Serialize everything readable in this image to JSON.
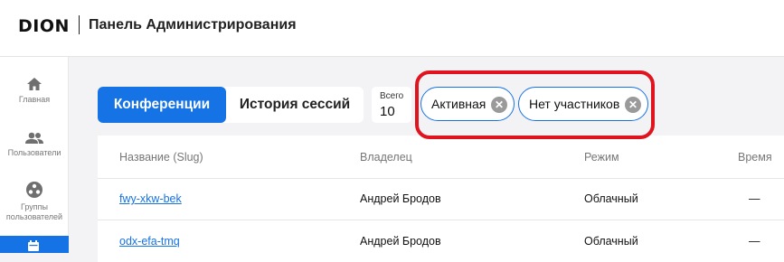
{
  "header": {
    "logo": "DION",
    "title": "Панель Администрирования"
  },
  "sidebar": {
    "items": [
      {
        "icon": "home-icon",
        "label": "Главная"
      },
      {
        "icon": "users-icon",
        "label": "Пользователи"
      },
      {
        "icon": "groups-icon",
        "label_line1": "Группы",
        "label_line2": "пользователей"
      },
      {
        "icon": "calendar-icon",
        "label": "",
        "active": true
      }
    ]
  },
  "tabs": [
    {
      "label": "Конференции",
      "active": true
    },
    {
      "label": "История сессий",
      "active": false
    }
  ],
  "total": {
    "label": "Всего",
    "value": "10"
  },
  "filters": [
    {
      "label": "Активная"
    },
    {
      "label": "Нет участников"
    }
  ],
  "table": {
    "columns": [
      "Название (Slug)",
      "Владелец",
      "Режим",
      "Время"
    ],
    "rows": [
      {
        "slug": "fwy-xkw-bek",
        "owner": "Андрей Бродов",
        "mode": "Облачный",
        "time": "—"
      },
      {
        "slug": "odx-efa-tmq",
        "owner": "Андрей Бродов",
        "mode": "Облачный",
        "time": "—"
      }
    ]
  },
  "colors": {
    "accent": "#1673e6",
    "highlight": "#e0141e"
  }
}
